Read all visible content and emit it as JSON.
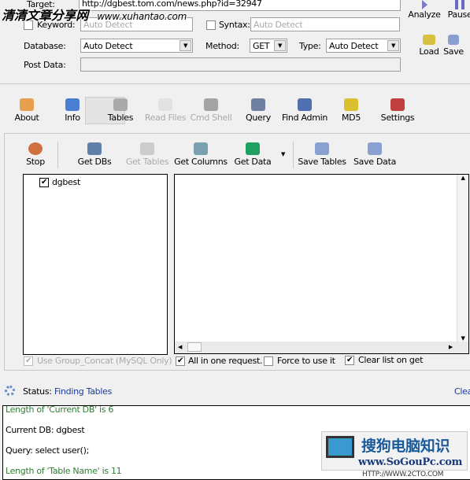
{
  "top": {
    "target_label": "Target:",
    "target_value": "http://dgbest.tom.com/news.php?id=32947",
    "keyword_label": "Keyword:",
    "keyword_placeholder": "Auto Detect",
    "syntax_label": "Syntax:",
    "syntax_placeholder": "Auto Detect",
    "database_label": "Database:",
    "database_value": "Auto Detect",
    "method_label": "Method:",
    "method_value": "GET",
    "type_label": "Type:",
    "type_value": "Auto Detect",
    "post_label": "Post Data:",
    "post_value": "",
    "analyze": "Analyze",
    "pause": "Pause",
    "load": "Load",
    "save": "Save"
  },
  "watermark_top": {
    "title": "清清文章分享网",
    "url": "www.xuhantao.com"
  },
  "tabs": [
    "About",
    "Info",
    "Tables",
    "Read Files",
    "Cmd Shell",
    "Query",
    "Find Admin",
    "MD5",
    "Settings"
  ],
  "toolbar": [
    "Stop",
    "Get DBs",
    "Get Tables",
    "Get Columns",
    "Get Data",
    "Save Tables",
    "Save Data"
  ],
  "tree": {
    "item": "dgbest",
    "checked": true
  },
  "options": {
    "group_concat": "Use Group_Concat (MySQL Only)",
    "all_in_one": "All in one request.",
    "force": "Force to use it",
    "clear_list": "Clear list on get"
  },
  "status": {
    "label": "Status:",
    "value": "Finding Tables",
    "clear": "Clea"
  },
  "log": [
    {
      "text": "Length of 'Current DB' is 6",
      "color": "#2e7d32"
    },
    {
      "text": "Current DB: dgbest",
      "color": "#000000"
    },
    {
      "text": "Query: select user();",
      "color": "#000000"
    },
    {
      "text": "Length of 'Table Name' is 11",
      "color": "#2e7d32"
    }
  ],
  "watermark_bottom": {
    "title": "搜狗电脑知识",
    "url": "www.SoGouPc.com",
    "sub": "HTTP://WWW.2CTO.COM"
  }
}
